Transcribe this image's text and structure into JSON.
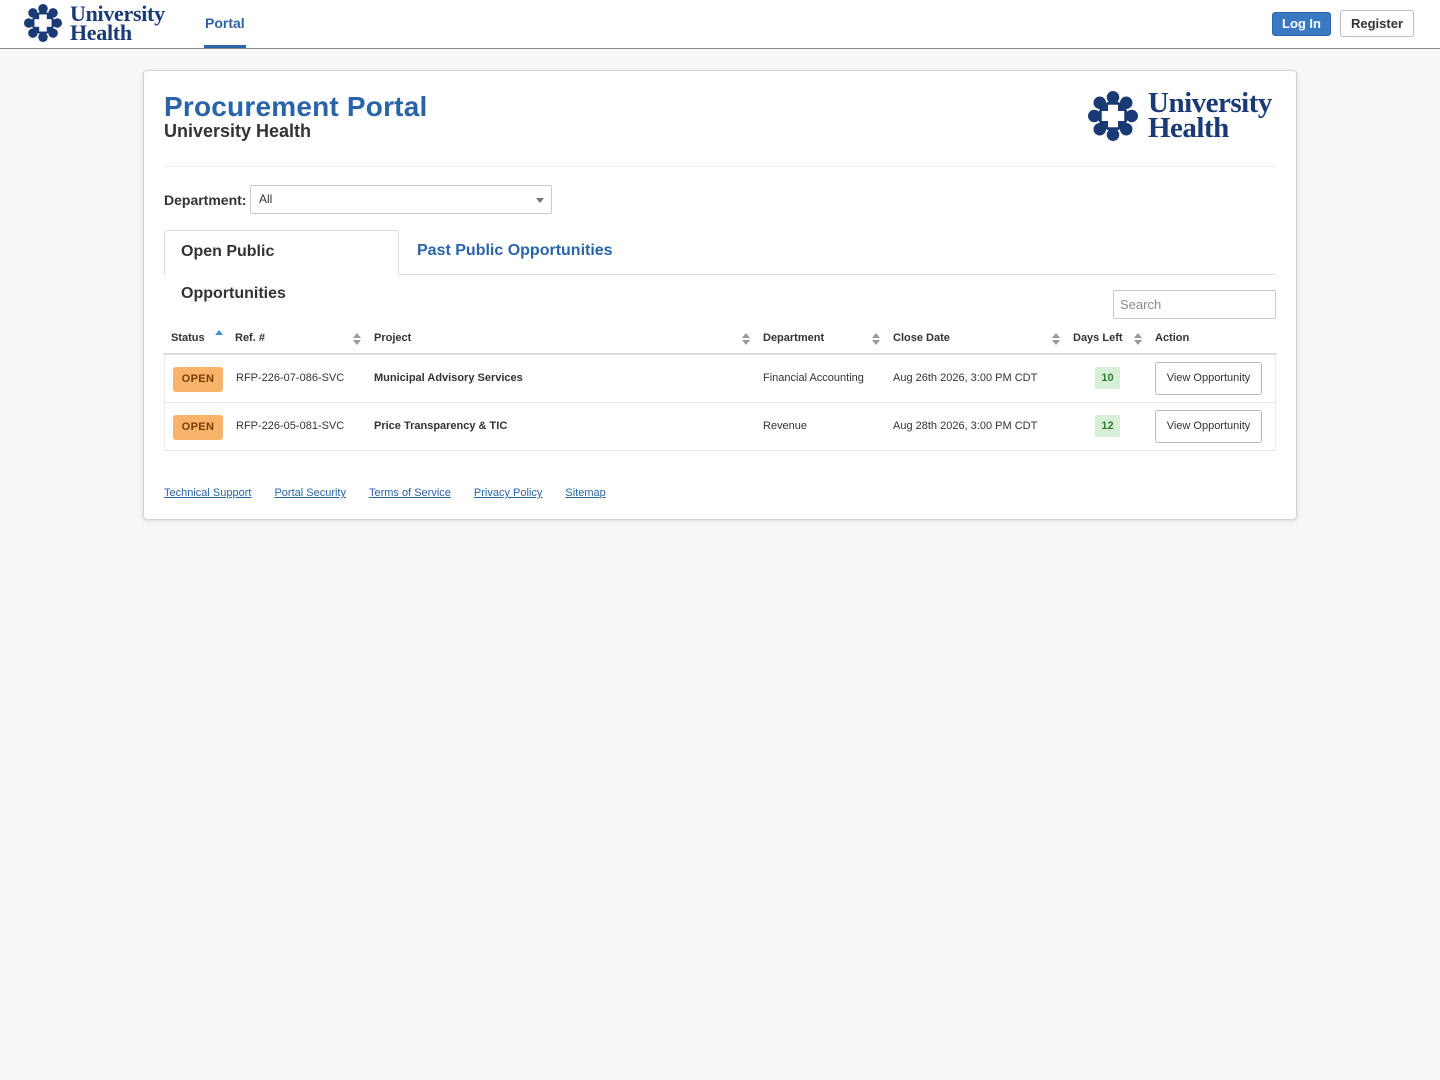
{
  "brand": {
    "line1": "University",
    "line2": "Health",
    "logo_icon": "star-flower-logo-icon",
    "logo_color": "#1a3a75"
  },
  "nav": {
    "portal_label": "Portal",
    "login_label": "Log In",
    "register_label": "Register"
  },
  "header": {
    "title": "Procurement Portal",
    "subtitle": "University Health"
  },
  "filter": {
    "department_label": "Department:",
    "department_value": "All"
  },
  "tabs": [
    {
      "label": "Open Public Opportunities",
      "active": true
    },
    {
      "label": "Past Public Opportunities",
      "active": false
    }
  ],
  "search": {
    "placeholder": "Search"
  },
  "table": {
    "columns": [
      "Status",
      "Ref. #",
      "Project",
      "Department",
      "Close Date",
      "Days Left",
      "Action"
    ],
    "rows": [
      {
        "status": "OPEN",
        "ref": "RFP-226-07-086-SVC",
        "project": "Municipal Advisory Services",
        "department": "Financial Accounting",
        "close_date": "Aug 26th 2026, 3:00 PM CDT",
        "days_left": "10",
        "action": "View Opportunity"
      },
      {
        "status": "OPEN",
        "ref": "RFP-226-05-081-SVC",
        "project": "Price Transparency & TIC",
        "department": "Revenue",
        "close_date": "Aug 28th 2026, 3:00 PM CDT",
        "days_left": "12",
        "action": "View Opportunity"
      }
    ]
  },
  "footer": {
    "links": [
      "Technical Support",
      "Portal Security",
      "Terms of Service",
      "Privacy Policy",
      "Sitemap"
    ]
  },
  "colors": {
    "accent": "#2a64a8",
    "login_button": "#3b78c4",
    "status_open": "#f8b36b",
    "days_left_badge": "#d7efd7"
  }
}
